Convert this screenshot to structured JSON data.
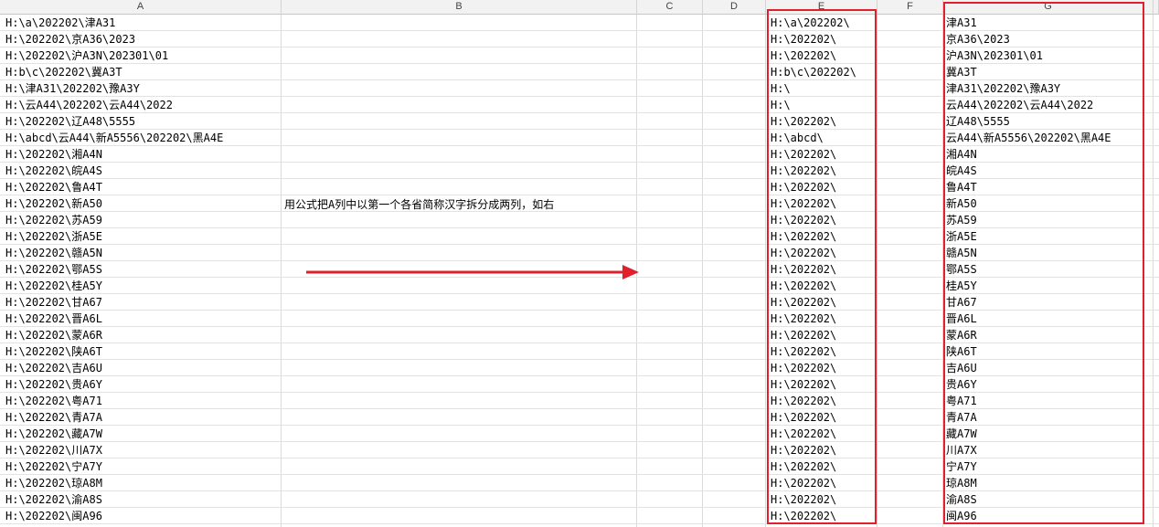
{
  "columns": [
    "A",
    "B",
    "C",
    "D",
    "E",
    "F",
    "G"
  ],
  "annotation": "用公式把A列中以第一个各省简称汉字拆分成两列，如右",
  "col_a": [
    "H:\\a\\202202\\津A31",
    "H:\\202202\\京A36\\2023",
    "H:\\202202\\沪A3N\\202301\\01",
    "H:b\\c\\202202\\冀A3T",
    "H:\\津A31\\202202\\豫A3Y",
    "H:\\云A44\\202202\\云A44\\2022",
    "H:\\202202\\辽A48\\5555",
    "H:\\abcd\\云A44\\新A5556\\202202\\黑A4E",
    "H:\\202202\\湘A4N",
    "H:\\202202\\皖A4S",
    "H:\\202202\\鲁A4T",
    "H:\\202202\\新A50",
    "H:\\202202\\苏A59",
    "H:\\202202\\浙A5E",
    "H:\\202202\\赣A5N",
    "H:\\202202\\鄂A5S",
    "H:\\202202\\桂A5Y",
    "H:\\202202\\甘A67",
    "H:\\202202\\晋A6L",
    "H:\\202202\\蒙A6R",
    "H:\\202202\\陕A6T",
    "H:\\202202\\吉A6U",
    "H:\\202202\\贵A6Y",
    "H:\\202202\\粤A71",
    "H:\\202202\\青A7A",
    "H:\\202202\\藏A7W",
    "H:\\202202\\川A7X",
    "H:\\202202\\宁A7Y",
    "H:\\202202\\琼A8M",
    "H:\\202202\\渝A8S",
    "H:\\202202\\闽A96"
  ],
  "col_e": [
    "H:\\a\\202202\\",
    "H:\\202202\\",
    "H:\\202202\\",
    "H:b\\c\\202202\\",
    "H:\\",
    "H:\\",
    "H:\\202202\\",
    "H:\\abcd\\",
    "H:\\202202\\",
    "H:\\202202\\",
    "H:\\202202\\",
    "H:\\202202\\",
    "H:\\202202\\",
    "H:\\202202\\",
    "H:\\202202\\",
    "H:\\202202\\",
    "H:\\202202\\",
    "H:\\202202\\",
    "H:\\202202\\",
    "H:\\202202\\",
    "H:\\202202\\",
    "H:\\202202\\",
    "H:\\202202\\",
    "H:\\202202\\",
    "H:\\202202\\",
    "H:\\202202\\",
    "H:\\202202\\",
    "H:\\202202\\",
    "H:\\202202\\",
    "H:\\202202\\",
    "H:\\202202\\"
  ],
  "col_g": [
    "津A31",
    "京A36\\2023",
    "沪A3N\\202301\\01",
    "冀A3T",
    "津A31\\202202\\豫A3Y",
    "云A44\\202202\\云A44\\2022",
    "辽A48\\5555",
    "云A44\\新A5556\\202202\\黑A4E",
    "湘A4N",
    "皖A4S",
    "鲁A4T",
    "新A50",
    "苏A59",
    "浙A5E",
    "赣A5N",
    "鄂A5S",
    "桂A5Y",
    "甘A67",
    "晋A6L",
    "蒙A6R",
    "陕A6T",
    "吉A6U",
    "贵A6Y",
    "粤A71",
    "青A7A",
    "藏A7W",
    "川A7X",
    "宁A7Y",
    "琼A8M",
    "渝A8S",
    "闽A96"
  ],
  "colors": {
    "highlight": "#e0202a",
    "grid": "#dadada",
    "header_bg": "#f2f2f2"
  }
}
